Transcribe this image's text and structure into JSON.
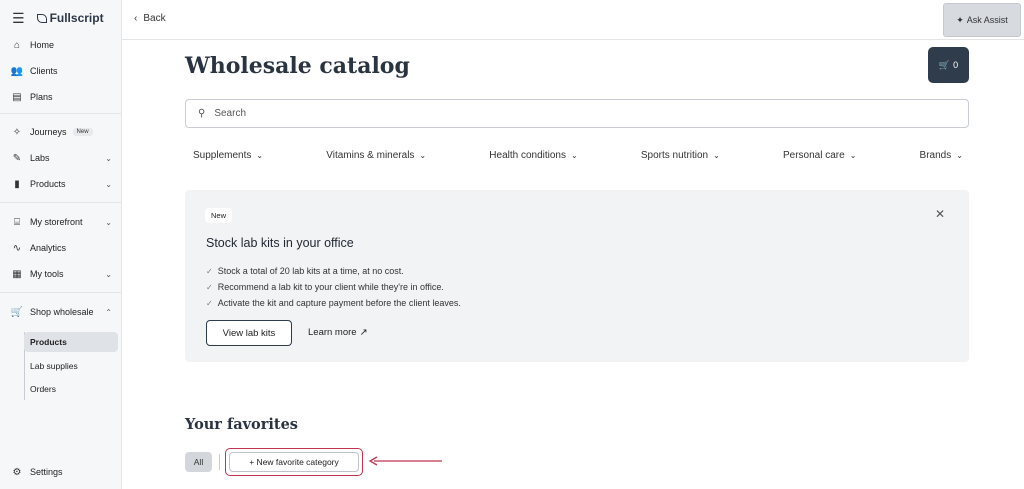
{
  "app": {
    "brand": "Fullscript"
  },
  "sidebar": {
    "items": [
      {
        "label": "Home"
      },
      {
        "label": "Clients"
      },
      {
        "label": "Plans"
      },
      {
        "label": "Journeys",
        "badge": "New"
      },
      {
        "label": "Labs"
      },
      {
        "label": "Products"
      },
      {
        "label": "My storefront"
      },
      {
        "label": "Analytics"
      },
      {
        "label": "My tools"
      },
      {
        "label": "Shop wholesale"
      }
    ],
    "sub_items": [
      {
        "label": "Products",
        "active": true
      },
      {
        "label": "Lab supplies"
      },
      {
        "label": "Orders"
      }
    ],
    "settings": "Settings"
  },
  "topbar": {
    "back_label": "Back",
    "assist_label": "Ask Assist"
  },
  "main": {
    "title": "Wholesale catalog",
    "cart_count": "0",
    "search_placeholder": "Search",
    "categories": [
      {
        "label": "Supplements"
      },
      {
        "label": "Vitamins & minerals"
      },
      {
        "label": "Health conditions"
      },
      {
        "label": "Sports nutrition"
      },
      {
        "label": "Personal care"
      },
      {
        "label": "Brands"
      }
    ]
  },
  "banner": {
    "badge": "New",
    "title": "Stock lab kits in your office",
    "bullets": [
      "Stock a total of 20 lab kits at a time, at no cost.",
      "Recommend a lab kit to your client while they're in office.",
      "Activate the kit and capture payment before the client leaves."
    ],
    "primary_button": "View lab kits",
    "link": "Learn more"
  },
  "favorites": {
    "title": "Your favorites",
    "all_label": "All",
    "new_category_button": "+ New favorite category"
  },
  "colors": {
    "accent_dark": "#2f3c4c",
    "highlight": "#c0344f",
    "banner_bg": "#f2f3f5"
  }
}
